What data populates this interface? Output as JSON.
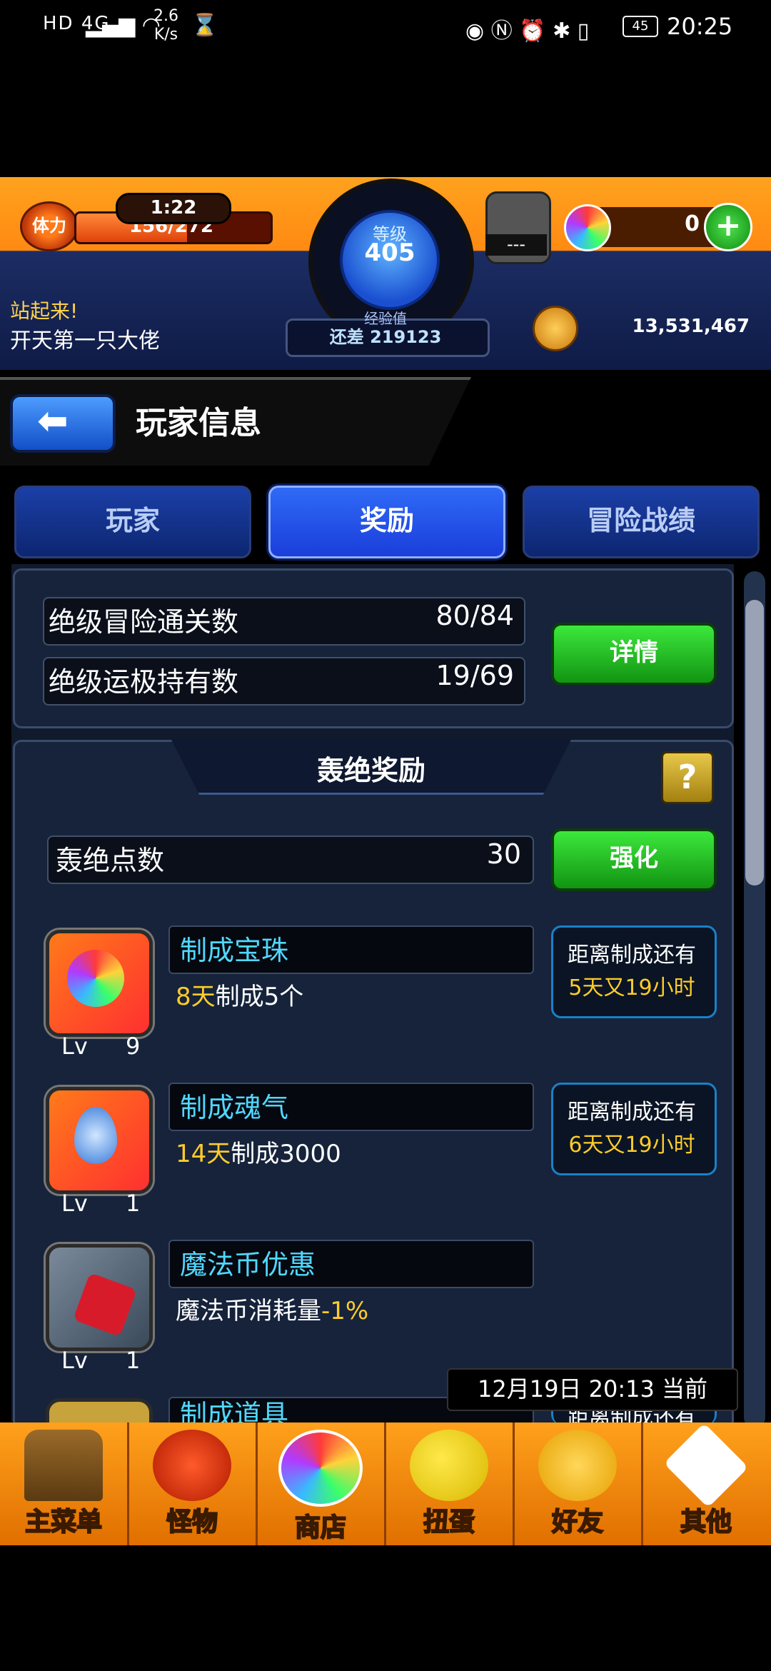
{
  "status_bar": {
    "left_icons": "HD 4G",
    "speed": "2.6\nK/s",
    "battery": "45",
    "time": "20:25"
  },
  "header": {
    "stamina_label": "体力",
    "stamina_timer": "1:22",
    "stamina_value": "156/272",
    "stamina_ratio": 0.57,
    "level_label": "等级",
    "level": "405",
    "orb_slot_text": "---",
    "orb_count": "0",
    "greeting_line1": "站起来!",
    "greeting_line2": "开天第一只大佬",
    "exp_label": "经验值",
    "exp_text": "还差 219123",
    "money": "13,531,467"
  },
  "title_bar": {
    "title": "玩家信息"
  },
  "tabs": [
    {
      "label": "玩家"
    },
    {
      "label": "奖励"
    },
    {
      "label": "冒险战绩"
    }
  ],
  "stats": {
    "rows": [
      {
        "label": "绝级冒险通关数",
        "value": "80/84"
      },
      {
        "label": "绝级运极持有数",
        "value": "19/69"
      }
    ],
    "detail_button": "详情"
  },
  "reward_section": {
    "title": "轰绝奖励",
    "help": "?",
    "points_label": "轰绝点数",
    "points_value": "30",
    "upgrade_button": "强化",
    "skills": [
      {
        "name": "制成宝珠",
        "desc_hl": "8天",
        "desc": "制成5个",
        "lv_label": "Lv",
        "lv": "9",
        "remain_1": "距离制成还有",
        "remain_2": "5天又19小时"
      },
      {
        "name": "制成魂气",
        "desc_hl": "14天",
        "desc": "制成3000",
        "lv_label": "Lv",
        "lv": "1",
        "remain_1": "距离制成还有",
        "remain_2": "6天又19小时"
      },
      {
        "name": "魔法币优惠",
        "desc": "魔法币消耗量",
        "desc_hl": "-1%",
        "lv_label": "Lv",
        "lv": "1"
      },
      {
        "name": "制成道具",
        "remain_1": "距离制成还有"
      }
    ],
    "current_time": "12月19日 20:13 当前"
  },
  "bottom_nav": [
    {
      "label": "主菜单",
      "icon": "castle-icon"
    },
    {
      "label": "怪物",
      "icon": "monster-icon"
    },
    {
      "label": "商店",
      "icon": "orb-icon"
    },
    {
      "label": "扭蛋",
      "icon": "egg-icon"
    },
    {
      "label": "好友",
      "icon": "friends-icon"
    },
    {
      "label": "其他",
      "icon": "other-icon"
    }
  ]
}
